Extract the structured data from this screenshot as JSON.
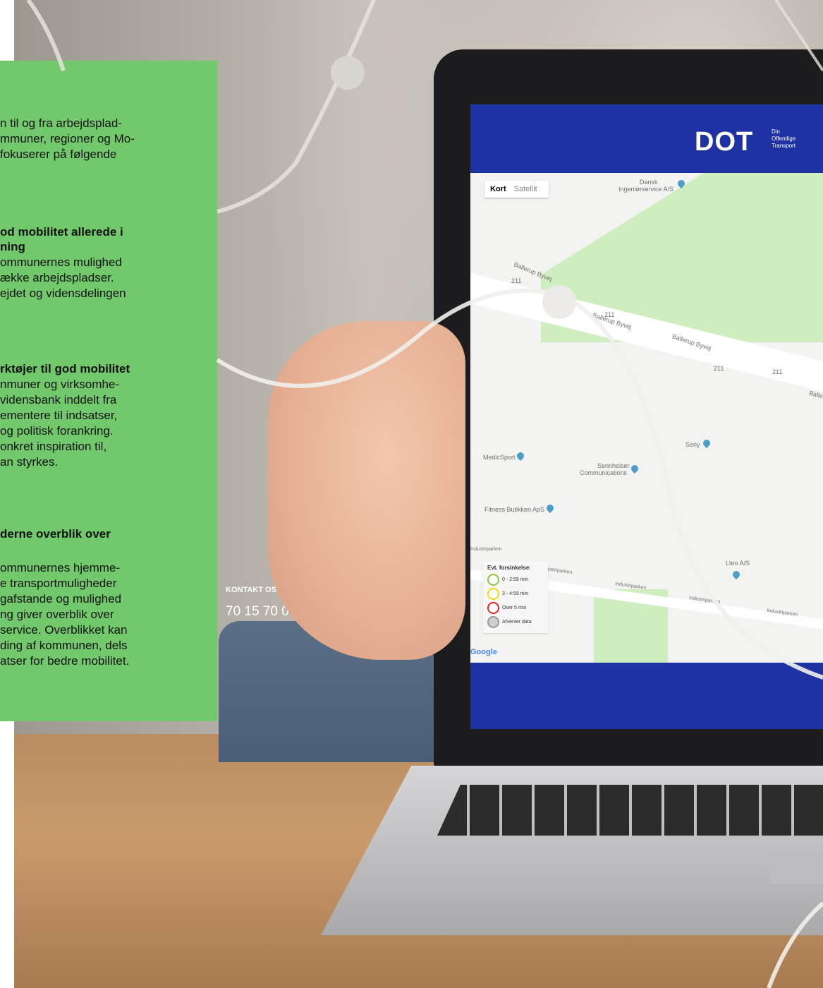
{
  "panel": {
    "lines": [
      {
        "text": "n til og fra arbejdsplad-",
        "bold": false
      },
      {
        "text": "mmuner, regioner og Mo-",
        "bold": false
      },
      {
        "text": "fokuserer på følgende",
        "bold": false
      },
      {
        "text": "od mobilitet allerede i",
        "bold": true
      },
      {
        "text": "ning",
        "bold": true
      },
      {
        "text": "ommunernes mulighed",
        "bold": false
      },
      {
        "text": "ække arbejdspladser.",
        "bold": false
      },
      {
        "text": "ejdet og vidensdelingen",
        "bold": false
      },
      {
        "text": "rktøjer til god mobilitet",
        "bold": true
      },
      {
        "text": "nmuner og virksomhe-",
        "bold": false
      },
      {
        "text": "vidensbank inddelt fra",
        "bold": false
      },
      {
        "text": "ementere til indsatser,",
        "bold": false
      },
      {
        "text": "og politisk forankring.",
        "bold": false
      },
      {
        "text": "onkret inspiration til,",
        "bold": false
      },
      {
        "text": "an styrkes.",
        "bold": false
      },
      {
        "text": "derne overblik over",
        "bold": true
      },
      {
        "text": "ommunernes hjemme-",
        "bold": false
      },
      {
        "text": "e transportmuligheder",
        "bold": false
      },
      {
        "text": "gafstande og mulighed",
        "bold": false
      },
      {
        "text": "ng giver overblik over",
        "bold": false
      },
      {
        "text": "service. Overblikket kan",
        "bold": false
      },
      {
        "text": "ding af kommunen, dels",
        "bold": false
      },
      {
        "text": "atser for bedre mobilitet.",
        "bold": false
      }
    ]
  },
  "screen": {
    "logo": "DOT",
    "logo_sub_1": "Din",
    "logo_sub_2": "Offentlige",
    "logo_sub_3": "Transport",
    "map_toggle_map": "Kort",
    "map_toggle_satellite": "Satellit",
    "map_labels": {
      "dansk": "Dansk",
      "ingenior": "Ingeniørservice A/S",
      "ballerup1": "Ballerup Byvej",
      "ballerup2": "Ballerup Byvej",
      "ballerup3": "Ballerup Byvej",
      "ballerup4": "Balleru",
      "road211a": "211",
      "road211b": "211",
      "road211c": "211",
      "road211d": "211",
      "sony": "Sony",
      "medicsport": "MedicSport",
      "sennheiser1": "Sennheiser",
      "sennheiser2": "Communications",
      "fitness": "Fitness Butikken ApS",
      "lteo": "Lteo A/S",
      "industri1": "Industriparken",
      "industri2": "Industriparken",
      "industri3": "Industriparken",
      "industri4": "Industriparken",
      "industri5": "Industriparken"
    },
    "legend": {
      "title": "Evt. forsinkelse:",
      "items": [
        {
          "label": "0 - 2:59 min",
          "color": "#8cc63f"
        },
        {
          "label": "3 - 4:59 min",
          "color": "#f5d90a"
        },
        {
          "label": "Over 5 min",
          "color": "#e2262a"
        },
        {
          "label": "Afventer data",
          "color": "#9a9a9a"
        }
      ]
    },
    "google": "Google",
    "contact_title": "KONTAKT OS",
    "contact_phone": "70 15 70 00"
  },
  "colors": {
    "panel_green": "#71c96b",
    "dot_blue": "#1f32a3"
  }
}
